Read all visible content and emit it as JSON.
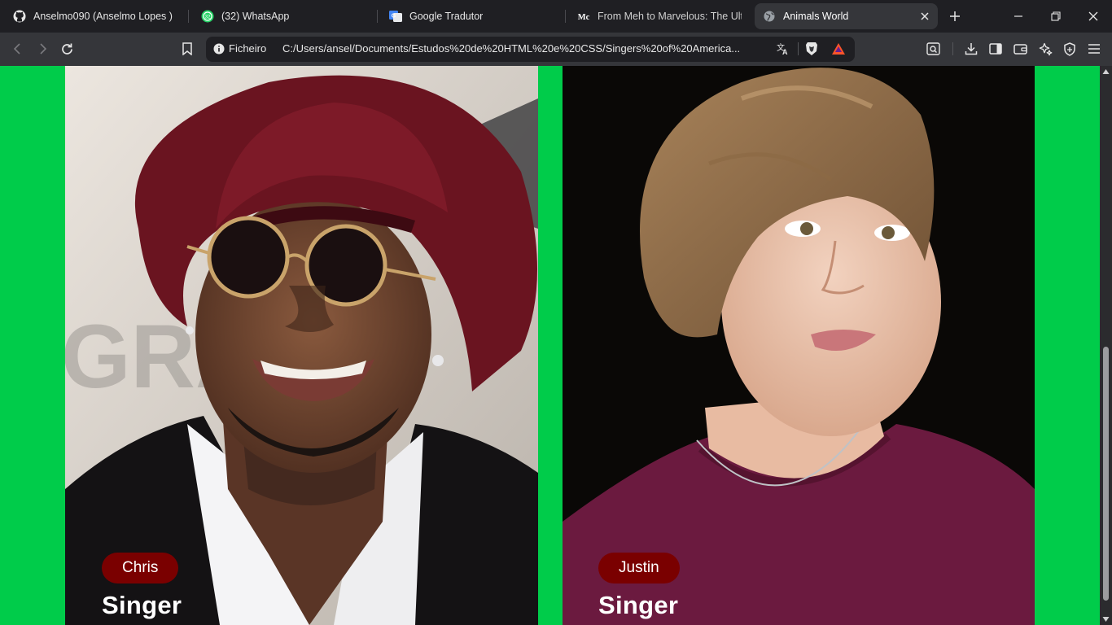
{
  "browser": {
    "tabs": [
      {
        "title": "Anselmo090 (Anselmo Lopes )",
        "icon": "github-icon",
        "active": false
      },
      {
        "title": "(32) WhatsApp",
        "icon": "whatsapp-icon",
        "badge": "32",
        "active": false
      },
      {
        "title": "Google Tradutor",
        "icon": "google-translate-icon",
        "active": false
      },
      {
        "title": "From Meh to Marvelous: The Ultim",
        "icon": "medium-icon",
        "active": false
      },
      {
        "title": "Animals World",
        "icon": "globe-icon",
        "active": true
      }
    ],
    "address": {
      "label": "Ficheiro",
      "url": "C:/Users/ansel/Documents/Estudos%20de%20HTML%20e%20CSS/Singers%20of%20America..."
    }
  },
  "page": {
    "background": "#00cc4a",
    "cards": [
      {
        "name": "Chris",
        "role": "Singer",
        "tag_color": "#7a0000"
      },
      {
        "name": "Justin",
        "role": "Singer",
        "tag_color": "#7a0000"
      }
    ]
  },
  "scrollbar": {
    "position_fraction": 0.55
  }
}
